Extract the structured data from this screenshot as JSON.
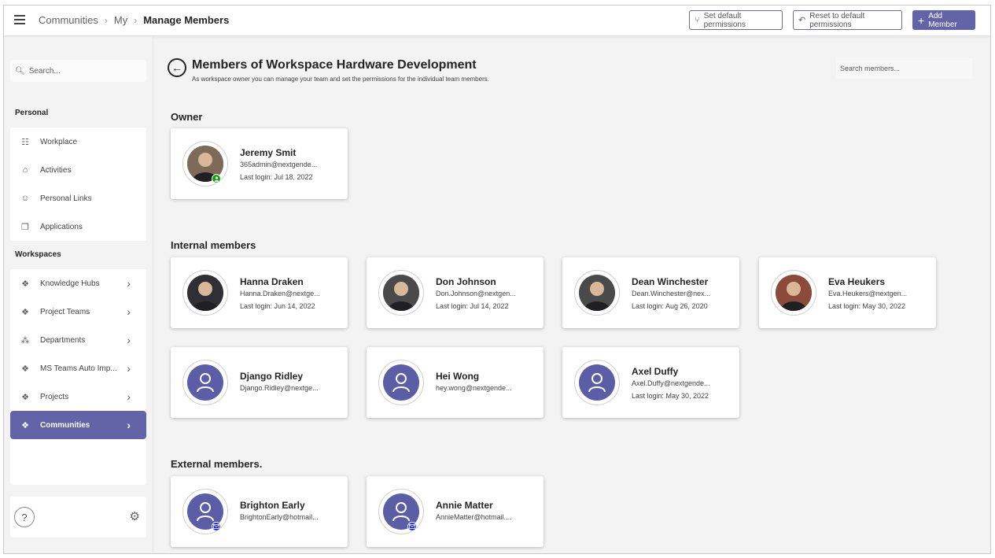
{
  "header": {
    "breadcrumb": [
      "Communities",
      "My",
      "Manage Members"
    ],
    "buttons": {
      "set_default": "Set default permissions",
      "reset_default": "Reset to default permissions",
      "add_member": "Add Member"
    }
  },
  "sidebar": {
    "search_placeholder": "Search...",
    "personal_title": "Personal",
    "personal_items": [
      {
        "label": "Workplace",
        "icon": "list-icon"
      },
      {
        "label": "Activities",
        "icon": "home-icon"
      },
      {
        "label": "Personal Links",
        "icon": "person-icon"
      },
      {
        "label": "Applications",
        "icon": "copy-icon"
      }
    ],
    "workspaces_title": "Workspaces",
    "workspace_items": [
      {
        "label": "Knowledge Hubs",
        "icon": "teams-icon"
      },
      {
        "label": "Project Teams",
        "icon": "teams-icon"
      },
      {
        "label": "Departments",
        "icon": "org-icon"
      },
      {
        "label": "MS Teams Auto Imp...",
        "icon": "teams-icon"
      },
      {
        "label": "Projects",
        "icon": "teams-icon"
      },
      {
        "label": "Communities",
        "icon": "teams-icon"
      }
    ],
    "help_label": "?"
  },
  "main": {
    "title": "Members of Workspace Hardware Development",
    "subtitle": "As workspace owner you can manage your team and set the permissions for the individual team members.",
    "search_placeholder": "Search members...",
    "sections": {
      "owner": "Owner",
      "internal": "Internal members",
      "external": "External members."
    },
    "owner": [
      {
        "name": "Jeremy Smit",
        "email": "365admin@nextgende...",
        "login": "Last login: Jul 18, 2022"
      }
    ],
    "internal": [
      {
        "name": "Hanna Draken",
        "email": "Hanna.Draken@nextge...",
        "login": "Last login: Jun 14, 2022"
      },
      {
        "name": "Don Johnson",
        "email": "Don.Johnson@nextgen...",
        "login": "Last login: Jul 14, 2022"
      },
      {
        "name": "Dean Winchester",
        "email": "Dean.Winchester@nex...",
        "login": "Last login: Aug 26, 2020"
      },
      {
        "name": "Eva Heukers",
        "email": "Eva.Heukers@nextgen...",
        "login": "Last login: May 30, 2022"
      },
      {
        "name": "Django Ridley",
        "email": "Django.Ridley@nextge...",
        "login": ""
      },
      {
        "name": "Hei Wong",
        "email": "hey.wong@nextgende...",
        "login": ""
      },
      {
        "name": "Axel Duffy",
        "email": "Axel.Duffy@nextgende...",
        "login": "Last login: May 30, 2022"
      }
    ],
    "external": [
      {
        "name": "Brighton Early",
        "email": "BrightonEarly@hotmail...",
        "login": ""
      },
      {
        "name": "Annie Matter",
        "email": "AnnieMatter@hotmail....",
        "login": ""
      }
    ]
  },
  "colors": {
    "accent": "#6264a7",
    "avatar_default": "#5b5ea6",
    "owner_badge": "#13a10e",
    "external_badge": "#1d2bdd"
  }
}
